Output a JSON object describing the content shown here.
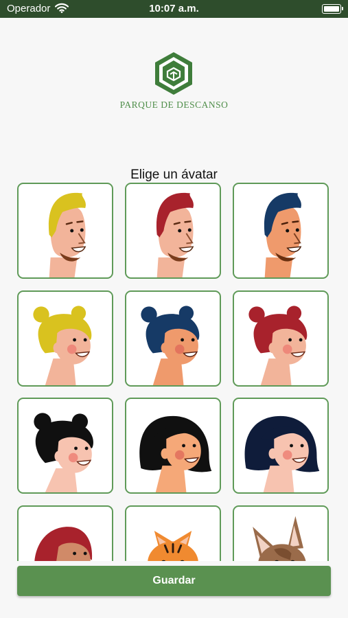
{
  "status_bar": {
    "carrier": "Operador",
    "time": "10:07 a.m."
  },
  "header": {
    "brand": "PARQUE DE DESCANSO"
  },
  "avatar_picker": {
    "heading": "Elige un ávatar",
    "avatars": [
      {
        "id": "boy-yellow-hair",
        "hair_color": "#d9c21f",
        "skin_color": "#f2b49a"
      },
      {
        "id": "boy-red-hair",
        "hair_color": "#a8222c",
        "skin_color": "#f2b49a"
      },
      {
        "id": "boy-navy-hair",
        "hair_color": "#163a66",
        "skin_color": "#ef9a6c"
      },
      {
        "id": "girl-yellow-buns",
        "hair_color": "#d9c21f",
        "skin_color": "#f2b49a"
      },
      {
        "id": "girl-navy-buns",
        "hair_color": "#163a66",
        "skin_color": "#ef9a6c"
      },
      {
        "id": "girl-red-buns",
        "hair_color": "#a8222c",
        "skin_color": "#f2b49a"
      },
      {
        "id": "girl-black-buns",
        "hair_color": "#101010",
        "skin_color": "#f7c3b0"
      },
      {
        "id": "girl-black-bob",
        "hair_color": "#101010",
        "skin_color": "#f5a878"
      },
      {
        "id": "girl-navy-bob",
        "hair_color": "#0f1c3a",
        "skin_color": "#f7c3b0"
      },
      {
        "id": "girl-red-hair",
        "hair_color": "#a8222c",
        "skin_color": "#d08a68"
      },
      {
        "id": "cat-orange",
        "hair_color": "#f08a30",
        "skin_color": "#f08a30"
      },
      {
        "id": "dog-brown",
        "hair_color": "#9a6b4a",
        "skin_color": "#9a6b4a"
      }
    ]
  },
  "footer": {
    "save_label": "Guardar"
  },
  "colors": {
    "status_bar": "#2e4d2c",
    "accent": "#5a9150",
    "card_border": "#5f9a58",
    "brand_text": "#4f8e4a"
  }
}
